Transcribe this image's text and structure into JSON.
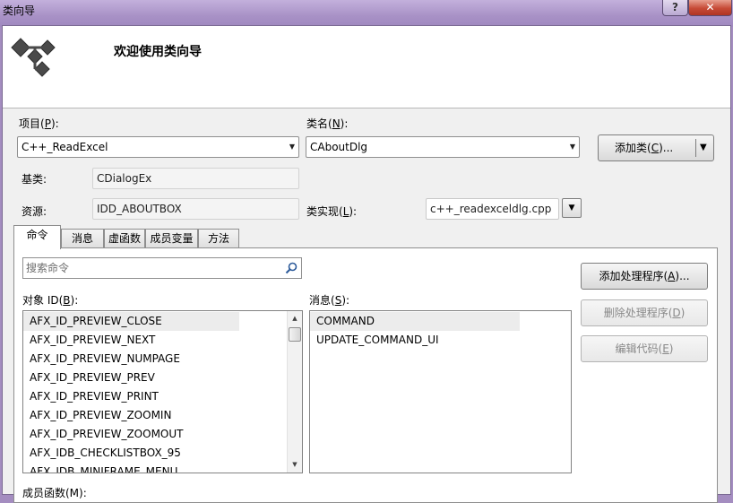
{
  "window": {
    "title": "类向导",
    "help_label": "?",
    "close_label": "✕"
  },
  "header": {
    "welcome": "欢迎使用类向导",
    "icon": "class-wizard-icon"
  },
  "project": {
    "label_pre": "项目(",
    "label_key": "P",
    "label_post": "):",
    "value": "C++_ReadExcel"
  },
  "class_name": {
    "label_pre": "类名(",
    "label_key": "N",
    "label_post": "):",
    "value": "CAboutDlg"
  },
  "add_class": {
    "label_pre": "添加类(",
    "label_key": "C",
    "label_post": ")..."
  },
  "base_class": {
    "label": "基类:",
    "value": "CDialogEx"
  },
  "resource": {
    "label": "资源:",
    "value": "IDD_ABOUTBOX"
  },
  "class_impl": {
    "label_pre": "类实现(",
    "label_key": "L",
    "label_post": "):",
    "value": "c++_readexceldlg.cpp"
  },
  "tabs": [
    {
      "label": "命令",
      "active": true
    },
    {
      "label": "消息",
      "active": false
    },
    {
      "label": "虚函数",
      "active": false
    },
    {
      "label": "成员变量",
      "active": false
    },
    {
      "label": "方法",
      "active": false
    }
  ],
  "search": {
    "placeholder": "搜索命令"
  },
  "object_ids": {
    "label_pre": "对象 ID(",
    "label_key": "B",
    "label_post": "):",
    "items": [
      "AFX_ID_PREVIEW_CLOSE",
      "AFX_ID_PREVIEW_NEXT",
      "AFX_ID_PREVIEW_NUMPAGE",
      "AFX_ID_PREVIEW_PREV",
      "AFX_ID_PREVIEW_PRINT",
      "AFX_ID_PREVIEW_ZOOMIN",
      "AFX_ID_PREVIEW_ZOOMOUT",
      "AFX_IDB_CHECKLISTBOX_95",
      "AFX_IDB_MINIFRAME_MENU"
    ]
  },
  "messages": {
    "label_pre": "消息(",
    "label_key": "S",
    "label_post": "):",
    "items": [
      "COMMAND",
      "UPDATE_COMMAND_UI"
    ]
  },
  "actions": {
    "add_handler": {
      "pre": "添加处理程序(",
      "key": "A",
      "post": ")..."
    },
    "delete_handler": {
      "pre": "删除处理程序(",
      "key": "D",
      "post": ")"
    },
    "edit_code": {
      "pre": "编辑代码(",
      "key": "E",
      "post": ")"
    }
  },
  "member_functions": {
    "label": "成员函数(M):"
  }
}
